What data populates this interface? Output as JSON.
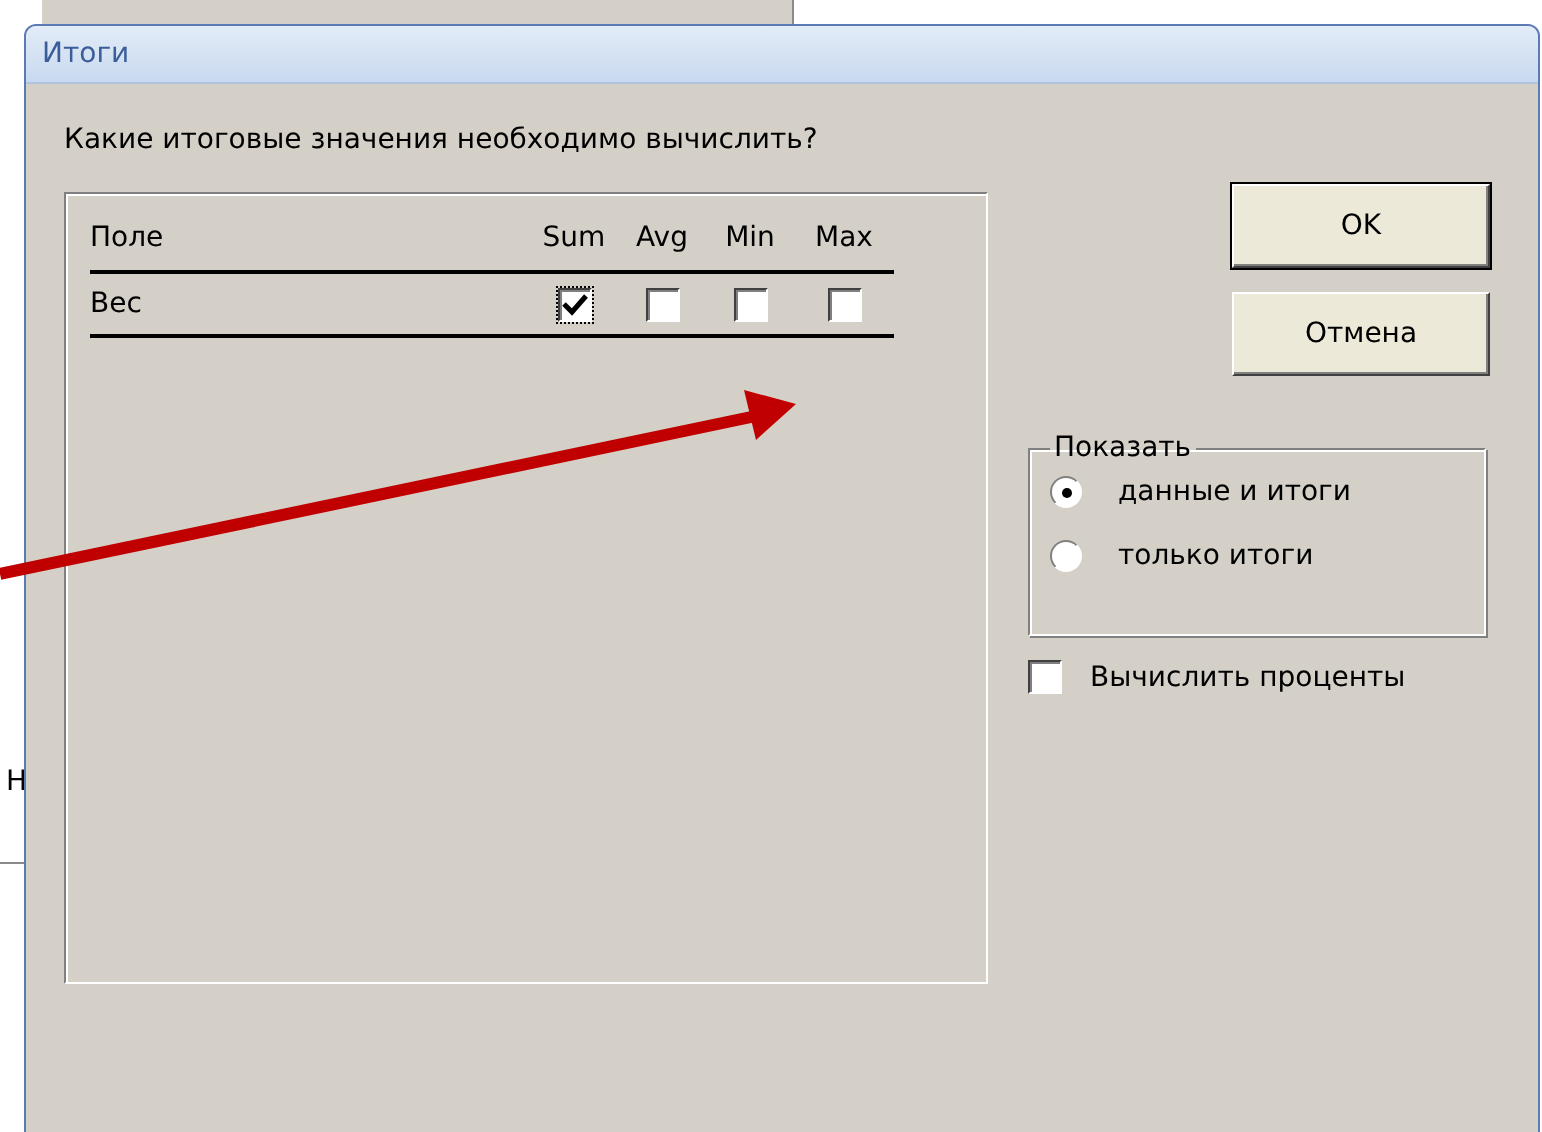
{
  "background_window": {
    "fragments": [
      "Н"
    ]
  },
  "window": {
    "title": "Итоги"
  },
  "question": "Какие итоговые значения необходимо вычислить?",
  "table": {
    "columns": [
      "Поле",
      "Sum",
      "Avg",
      "Min",
      "Max"
    ],
    "rows": [
      {
        "field": "Вес",
        "checks": [
          {
            "checked": true,
            "focused": true
          },
          {
            "checked": false,
            "focused": false
          },
          {
            "checked": false,
            "focused": false
          },
          {
            "checked": false,
            "focused": false
          }
        ]
      }
    ]
  },
  "buttons": [
    {
      "label": "OK",
      "default": true
    },
    {
      "label": "Отмена",
      "default": false
    }
  ],
  "show_group": {
    "legend": "Показать",
    "options": [
      {
        "label": "данные и итоги",
        "selected": true
      },
      {
        "label": "только итоги",
        "selected": false
      }
    ]
  },
  "percent_checkbox": {
    "label": "Вычислить проценты",
    "checked": false
  },
  "annotation": {
    "kind": "arrow"
  }
}
